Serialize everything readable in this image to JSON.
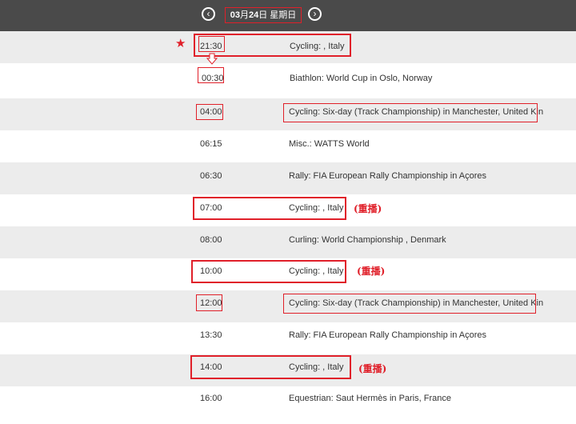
{
  "header": {
    "prev_icon": "chevron-left-icon",
    "next_icon": "chevron-right-icon",
    "date_month": "03",
    "date_mid": "月",
    "date_day": "24",
    "date_suffix": "日 星期日"
  },
  "annotations": {
    "star": "★",
    "rebroadcast": "(重播)",
    "accent_color": "#e0202a"
  },
  "rows": [
    {
      "time": "21:30",
      "event": "Cycling: , Italy"
    },
    {
      "time": "00:30",
      "event": "Biathlon: World Cup in Oslo, Norway"
    },
    {
      "time": "04:00",
      "event": "Cycling: Six-day (Track Championship) in Manchester, United Kin"
    },
    {
      "time": "06:15",
      "event": "Misc.: WATTS World"
    },
    {
      "time": "06:30",
      "event": "Rally: FIA European Rally Championship in Açores"
    },
    {
      "time": "07:00",
      "event": "Cycling: , Italy"
    },
    {
      "time": "08:00",
      "event": "Curling: World Championship , Denmark"
    },
    {
      "time": "10:00",
      "event": "Cycling: , Italy"
    },
    {
      "time": "12:00",
      "event": "Cycling: Six-day (Track Championship) in Manchester, United Kin"
    },
    {
      "time": "13:30",
      "event": "Rally: FIA European Rally Championship in Açores"
    },
    {
      "time": "14:00",
      "event": "Cycling: , Italy"
    },
    {
      "time": "16:00",
      "event": "Equestrian: Saut Hermès in Paris, France"
    }
  ]
}
